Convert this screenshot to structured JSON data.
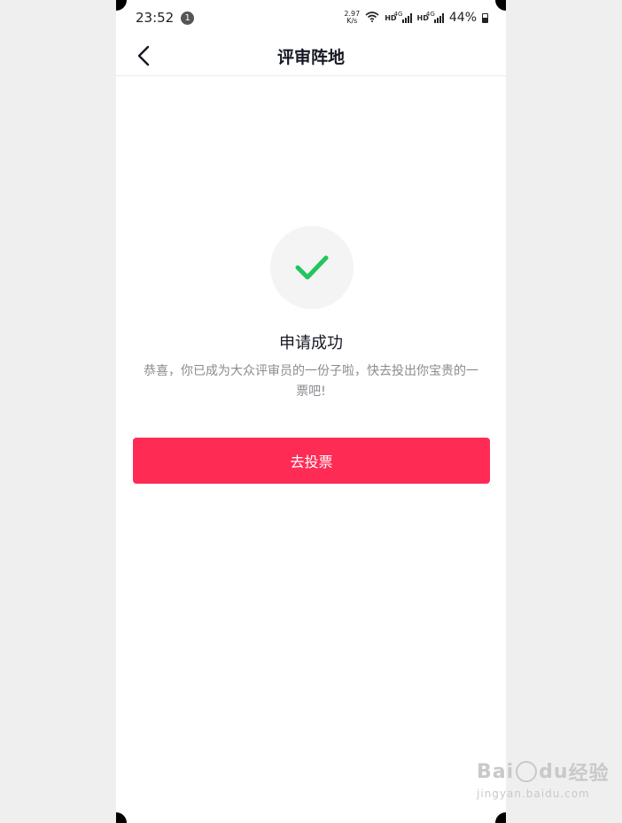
{
  "status_bar": {
    "time": "23:52",
    "notification_count": "1",
    "net_speed_value": "2.97",
    "net_speed_unit": "K/s",
    "hd_label": "HD",
    "network_type": "4G",
    "battery": "44%"
  },
  "nav": {
    "title": "评审阵地"
  },
  "result": {
    "title": "申请成功",
    "description": "恭喜，你已成为大众评审员的一份子啦，快去投出你宝贵的一票吧!"
  },
  "actions": {
    "vote_label": "去投票"
  },
  "watermark": {
    "brand_part1": "Bai",
    "brand_part2": "du",
    "brand_cn": "经验",
    "url": "jingyan.baidu.com"
  },
  "colors": {
    "accent": "#fe2c55",
    "check": "#22c55e",
    "title_text": "#161823",
    "secondary_text": "#8a8b91"
  }
}
